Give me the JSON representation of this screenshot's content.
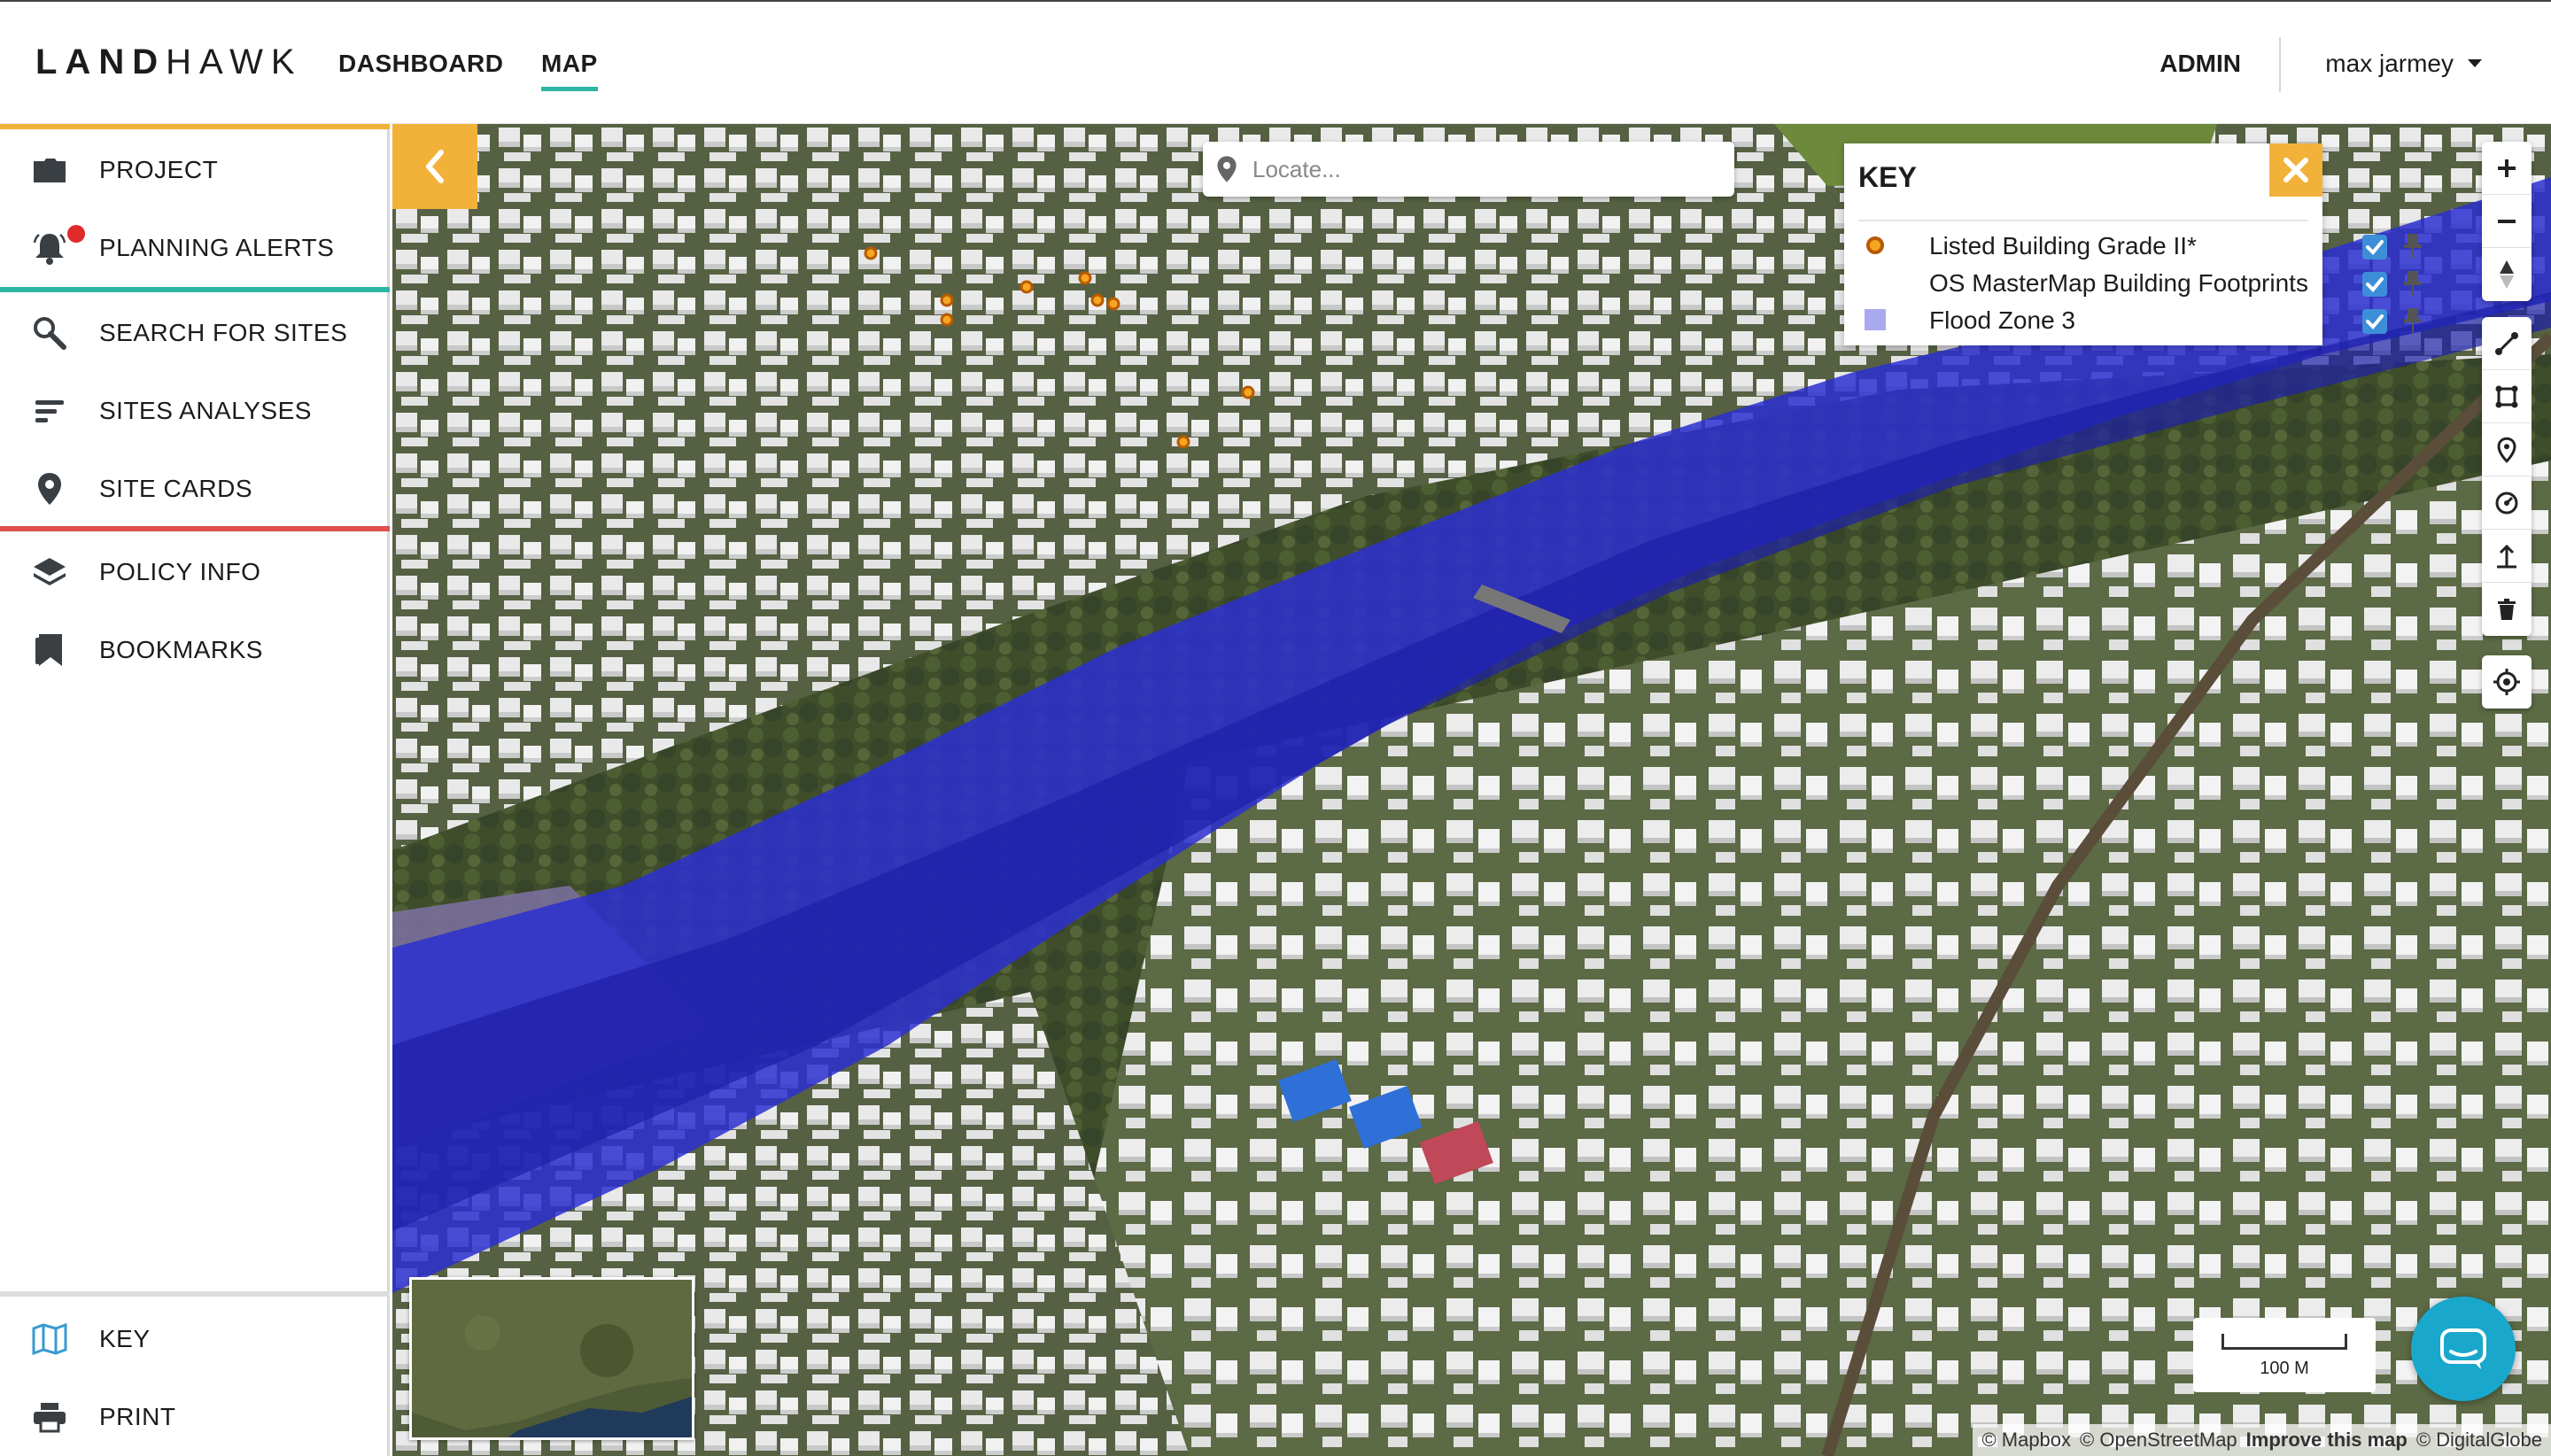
{
  "brand": {
    "logo_bold": "LAND",
    "logo_light": "HAWK"
  },
  "nav": {
    "links": [
      {
        "label": "DASHBOARD",
        "active": false
      },
      {
        "label": "MAP",
        "active": true
      }
    ],
    "admin": "ADMIN",
    "user": "max jarmey"
  },
  "sidebar": {
    "items": [
      {
        "label": "PROJECT",
        "icon": "folder-icon"
      },
      {
        "label": "PLANNING ALERTS",
        "icon": "bell-icon",
        "has_alert": true
      },
      {
        "label": "SEARCH FOR SITES",
        "icon": "search-icon"
      },
      {
        "label": "SITES ANALYSES",
        "icon": "bars-icon"
      },
      {
        "label": "SITE CARDS",
        "icon": "map-pin-icon"
      },
      {
        "label": "POLICY INFO",
        "icon": "layers-icon"
      },
      {
        "label": "BOOKMARKS",
        "icon": "bookmark-icon"
      }
    ],
    "footer_items": [
      {
        "label": "KEY",
        "icon": "map-icon"
      },
      {
        "label": "PRINT",
        "icon": "printer-icon"
      }
    ],
    "section_colors": {
      "project": "#f2b23a",
      "search": "#2fb5a3",
      "policy": "#e05050"
    }
  },
  "map": {
    "locate_placeholder": "Locate...",
    "key": {
      "title": "KEY",
      "layers": [
        {
          "name": "Listed Building Grade II*",
          "symbol": "orange-ring",
          "checked": true
        },
        {
          "name": "OS MasterMap Building Footprints",
          "symbol": "none",
          "checked": true
        },
        {
          "name": "Flood Zone 3",
          "symbol": "blue-square",
          "checked": true
        }
      ]
    },
    "scale_label": "100 M",
    "attribution": {
      "mapbox": "© Mapbox",
      "osm": "© OpenStreetMap",
      "improve": "Improve this map",
      "digitalglobe": "© DigitalGlobe"
    },
    "colors": {
      "flood": "#2b2fd0",
      "accent": "#f2b23a",
      "teal": "#2fb5a3"
    }
  }
}
